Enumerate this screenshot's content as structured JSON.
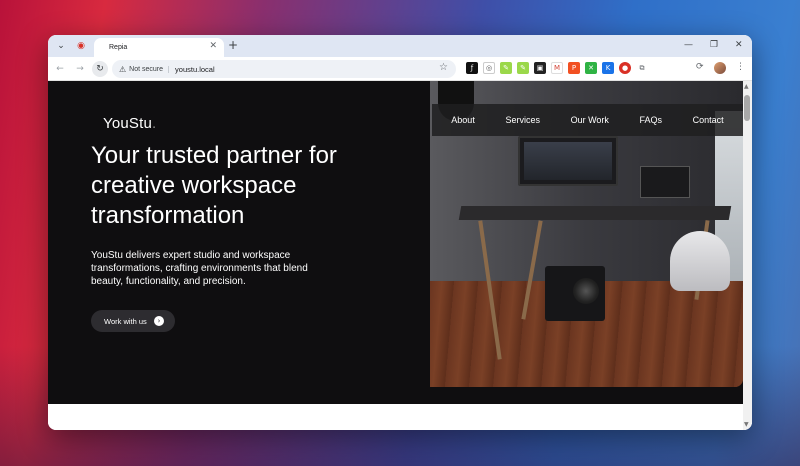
{
  "browser": {
    "tab_title": "Repia",
    "url": "youstu.local",
    "security_label": "Not secure"
  },
  "site": {
    "logo": "YouStu",
    "logo_dot": ".",
    "nav": [
      "About",
      "Services",
      "Our Work",
      "FAQs",
      "Contact"
    ],
    "headline": "Your trusted partner for creative workspace transformation",
    "subheadline": "YouStu delivers expert studio and workspace transformations, crafting environments that blend beauty, functionality, and precision.",
    "cta_label": "Work with us"
  },
  "colors": {
    "hero_bg": "#0f0e10",
    "cta_bg": "#2d2c30",
    "tabbar_bg": "#dfe6f3"
  }
}
